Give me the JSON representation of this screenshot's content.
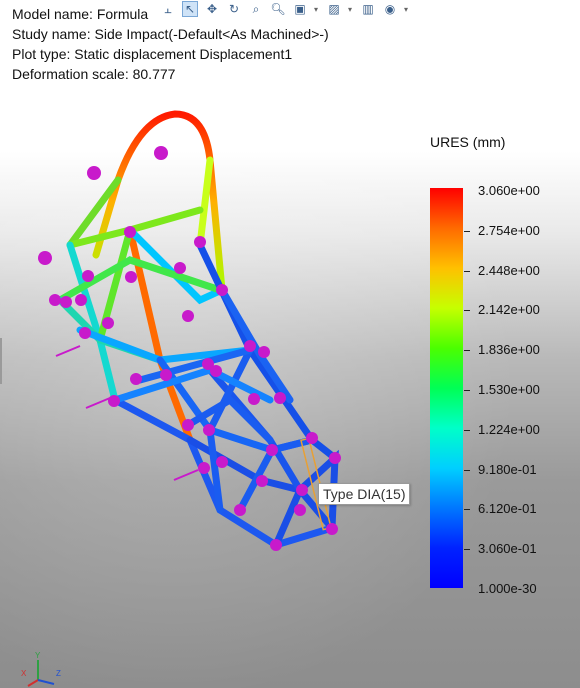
{
  "info": {
    "model_name": "Model name: Formula",
    "study_name": "Study name: Side Impact(-Default<As Machined>-)",
    "plot_type": "Plot type: Static displacement Displacement1",
    "deformation_scale": "Deformation scale: 80.777"
  },
  "legend": {
    "title": "URES (mm)",
    "labels": [
      "3.060e+00",
      "2.754e+00",
      "2.448e+00",
      "2.142e+00",
      "1.836e+00",
      "1.530e+00",
      "1.224e+00",
      "9.180e-01",
      "6.120e-01",
      "3.060e-01",
      "1.000e-30"
    ],
    "colors": {
      "max": "#ff0000",
      "min": "#0000ff"
    }
  },
  "tooltip": "Type DIA(15)",
  "toolbar": {
    "icons": [
      "pin-icon",
      "select-arrow-icon",
      "pan-icon",
      "rotate-icon",
      "zoom-area-icon",
      "zoom-icon",
      "view-orientation-icon",
      "display-style-icon",
      "section-view-icon",
      "appearance-icon"
    ]
  },
  "triad": {
    "y_label": "Y",
    "x_label": "X",
    "z_label": "Z"
  }
}
